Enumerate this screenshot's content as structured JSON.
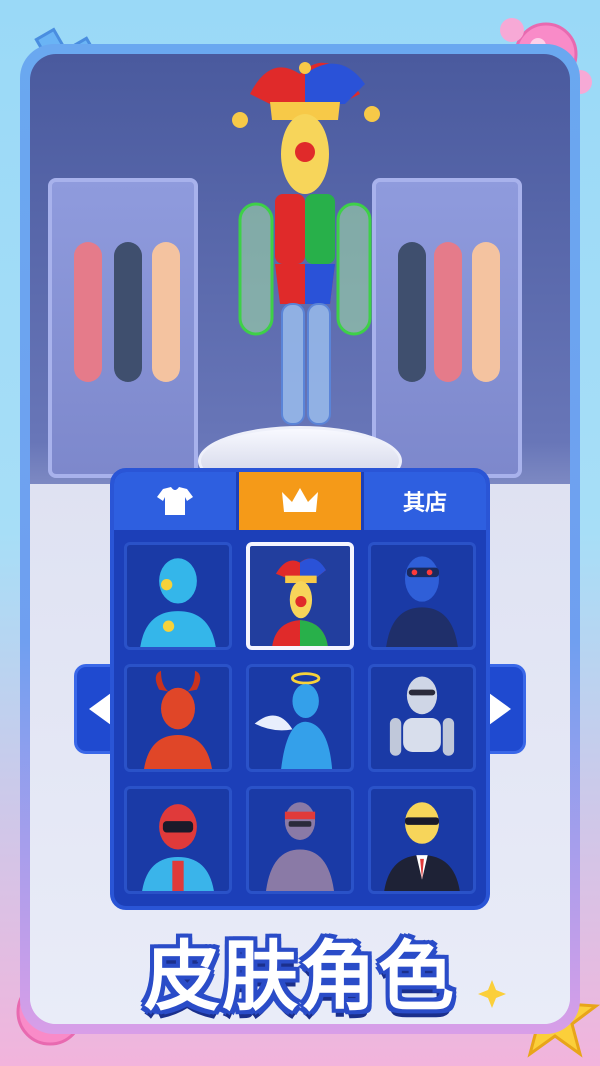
{
  "tabs": [
    {
      "label": "",
      "icon": "clothing-icon",
      "active": false
    },
    {
      "label": "",
      "icon": "crown-icon",
      "active": true
    },
    {
      "label": "其店",
      "icon": "",
      "active": false
    }
  ],
  "skins": [
    {
      "name": "crash-test-dummy",
      "selected": false
    },
    {
      "name": "jester",
      "selected": true
    },
    {
      "name": "cyber-ninja",
      "selected": false
    },
    {
      "name": "demon",
      "selected": false
    },
    {
      "name": "angel",
      "selected": false
    },
    {
      "name": "robot",
      "selected": false
    },
    {
      "name": "racer",
      "selected": false
    },
    {
      "name": "ninja",
      "selected": false
    },
    {
      "name": "agent",
      "selected": false
    }
  ],
  "banner": {
    "title": "皮肤角色"
  },
  "colors": {
    "panel": "#1c3fb8",
    "tab": "#2e5fe0",
    "tab_active": "#f59a18",
    "banner_stroke": "#2a4cc8"
  }
}
